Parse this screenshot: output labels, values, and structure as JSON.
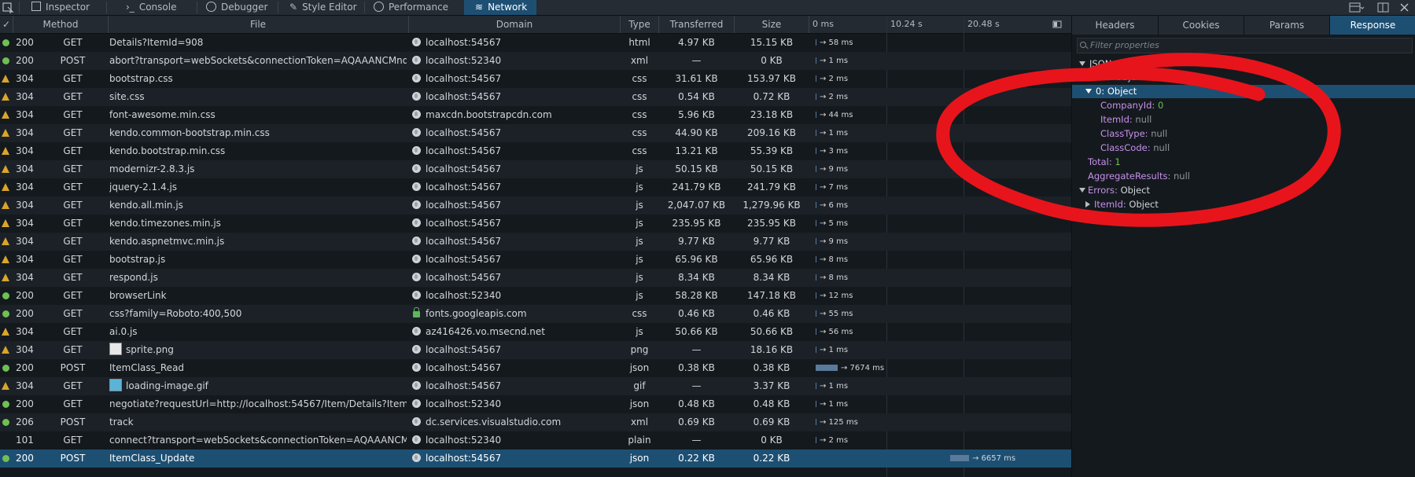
{
  "toolbar": {
    "tabs": [
      {
        "label": "Inspector"
      },
      {
        "label": "Console"
      },
      {
        "label": "Debugger"
      },
      {
        "label": "Style Editor"
      },
      {
        "label": "Performance"
      },
      {
        "label": "Network"
      }
    ],
    "selected": "Network"
  },
  "columns": {
    "check": "✓",
    "method": "Method",
    "file": "File",
    "domain": "Domain",
    "type": "Type",
    "transferred": "Transferred",
    "size": "Size",
    "timeline_ticks": [
      "0 ms",
      "10.24 s",
      "20.48 s"
    ]
  },
  "requests": [
    {
      "status": "200",
      "method": "GET",
      "file": "Details?ItemId=908",
      "domain": "localhost:54567",
      "type": "html",
      "transferred": "4.97 KB",
      "size": "15.15 KB",
      "time": "→ 58 ms",
      "ok": true
    },
    {
      "status": "200",
      "method": "POST",
      "file": "abort?transport=webSockets&connectionToken=AQAAANCMnd8BF...",
      "domain": "localhost:52340",
      "type": "xml",
      "transferred": "—",
      "size": "0 KB",
      "time": "→ 1 ms",
      "ok": true
    },
    {
      "status": "304",
      "method": "GET",
      "file": "bootstrap.css",
      "domain": "localhost:54567",
      "type": "css",
      "transferred": "31.61 KB",
      "size": "153.97 KB",
      "time": "→ 2 ms",
      "ok": false
    },
    {
      "status": "304",
      "method": "GET",
      "file": "site.css",
      "domain": "localhost:54567",
      "type": "css",
      "transferred": "0.54 KB",
      "size": "0.72 KB",
      "time": "→ 2 ms",
      "ok": false
    },
    {
      "status": "304",
      "method": "GET",
      "file": "font-awesome.min.css",
      "domain": "maxcdn.bootstrapcdn.com",
      "type": "css",
      "transferred": "5.96 KB",
      "size": "23.18 KB",
      "time": "→ 44 ms",
      "ok": false
    },
    {
      "status": "304",
      "method": "GET",
      "file": "kendo.common-bootstrap.min.css",
      "domain": "localhost:54567",
      "type": "css",
      "transferred": "44.90 KB",
      "size": "209.16 KB",
      "time": "→ 1 ms",
      "ok": false
    },
    {
      "status": "304",
      "method": "GET",
      "file": "kendo.bootstrap.min.css",
      "domain": "localhost:54567",
      "type": "css",
      "transferred": "13.21 KB",
      "size": "55.39 KB",
      "time": "→ 3 ms",
      "ok": false
    },
    {
      "status": "304",
      "method": "GET",
      "file": "modernizr-2.8.3.js",
      "domain": "localhost:54567",
      "type": "js",
      "transferred": "50.15 KB",
      "size": "50.15 KB",
      "time": "→ 9 ms",
      "ok": false
    },
    {
      "status": "304",
      "method": "GET",
      "file": "jquery-2.1.4.js",
      "domain": "localhost:54567",
      "type": "js",
      "transferred": "241.79 KB",
      "size": "241.79 KB",
      "time": "→ 7 ms",
      "ok": false
    },
    {
      "status": "304",
      "method": "GET",
      "file": "kendo.all.min.js",
      "domain": "localhost:54567",
      "type": "js",
      "transferred": "2,047.07 KB",
      "size": "1,279.96 KB",
      "time": "→ 6 ms",
      "ok": false
    },
    {
      "status": "304",
      "method": "GET",
      "file": "kendo.timezones.min.js",
      "domain": "localhost:54567",
      "type": "js",
      "transferred": "235.95 KB",
      "size": "235.95 KB",
      "time": "→ 5 ms",
      "ok": false
    },
    {
      "status": "304",
      "method": "GET",
      "file": "kendo.aspnetmvc.min.js",
      "domain": "localhost:54567",
      "type": "js",
      "transferred": "9.77 KB",
      "size": "9.77 KB",
      "time": "→ 9 ms",
      "ok": false
    },
    {
      "status": "304",
      "method": "GET",
      "file": "bootstrap.js",
      "domain": "localhost:54567",
      "type": "js",
      "transferred": "65.96 KB",
      "size": "65.96 KB",
      "time": "→ 8 ms",
      "ok": false
    },
    {
      "status": "304",
      "method": "GET",
      "file": "respond.js",
      "domain": "localhost:54567",
      "type": "js",
      "transferred": "8.34 KB",
      "size": "8.34 KB",
      "time": "→ 8 ms",
      "ok": false
    },
    {
      "status": "200",
      "method": "GET",
      "file": "browserLink",
      "domain": "localhost:52340",
      "type": "js",
      "transferred": "58.28 KB",
      "size": "147.18 KB",
      "time": "→ 12 ms",
      "ok": true
    },
    {
      "status": "200",
      "method": "GET",
      "file": "css?family=Roboto:400,500",
      "domain": "fonts.googleapis.com",
      "type": "css",
      "transferred": "0.46 KB",
      "size": "0.46 KB",
      "time": "→ 55 ms",
      "ok": true,
      "secure": true
    },
    {
      "status": "304",
      "method": "GET",
      "file": "ai.0.js",
      "domain": "az416426.vo.msecnd.net",
      "type": "js",
      "transferred": "50.66 KB",
      "size": "50.66 KB",
      "time": "→ 56 ms",
      "ok": false
    },
    {
      "status": "304",
      "method": "GET",
      "file": "sprite.png",
      "domain": "localhost:54567",
      "type": "png",
      "transferred": "—",
      "size": "18.16 KB",
      "time": "→ 1 ms",
      "ok": false,
      "thumb": "#e8e8e8"
    },
    {
      "status": "200",
      "method": "POST",
      "file": "ItemClass_Read",
      "domain": "localhost:54567",
      "type": "json",
      "transferred": "0.38 KB",
      "size": "0.38 KB",
      "time": "→ 7674 ms",
      "ok": true
    },
    {
      "status": "304",
      "method": "GET",
      "file": "loading-image.gif",
      "domain": "localhost:54567",
      "type": "gif",
      "transferred": "—",
      "size": "3.37 KB",
      "time": "→ 1 ms",
      "ok": false,
      "thumb": "#5ab4d8"
    },
    {
      "status": "200",
      "method": "GET",
      "file": "negotiate?requestUrl=http://localhost:54567/Item/Details?ItemId=908...",
      "domain": "localhost:52340",
      "type": "json",
      "transferred": "0.48 KB",
      "size": "0.48 KB",
      "time": "→ 1 ms",
      "ok": true
    },
    {
      "status": "206",
      "method": "POST",
      "file": "track",
      "domain": "dc.services.visualstudio.com",
      "type": "xml",
      "transferred": "0.69 KB",
      "size": "0.69 KB",
      "time": "→ 125 ms",
      "ok": true
    },
    {
      "status": "101",
      "method": "GET",
      "file": "connect?transport=webSockets&connectionToken=AQAAANCMnd8...",
      "domain": "localhost:52340",
      "type": "plain",
      "transferred": "—",
      "size": "0 KB",
      "time": "→ 2 ms",
      "ok": null
    },
    {
      "status": "200",
      "method": "POST",
      "file": "ItemClass_Update",
      "domain": "localhost:54567",
      "type": "json",
      "transferred": "0.22 KB",
      "size": "0.22 KB",
      "time": "→ 6657 ms",
      "ok": true,
      "selected": true
    }
  ],
  "side": {
    "tabs": [
      "Headers",
      "Cookies",
      "Params",
      "Response"
    ],
    "selected_tab": "Response",
    "filter_placeholder": "Filter properties",
    "tree": {
      "root": "JSON",
      "data_key": "Data:",
      "data_val": "Object",
      "item0_key": "0:",
      "item0_val": "Object",
      "company_key": "CompanyId:",
      "company_val": "0",
      "itemid_key": "ItemId:",
      "itemid_val": "null",
      "classtype_key": "ClassType:",
      "classtype_val": "null",
      "classcode_key": "ClassCode:",
      "classcode_val": "null",
      "total_key": "Total:",
      "total_val": "1",
      "agg_key": "AggregateResults:",
      "agg_val": "null",
      "errors_key": "Errors:",
      "errors_val": "Object",
      "erritem_key": "ItemId:",
      "erritem_val": "Object"
    }
  },
  "colors": {
    "ok": "#70bf53",
    "warn": "#d9a52a",
    "selected": "#1d4f73",
    "annotation": "#e8141b"
  }
}
